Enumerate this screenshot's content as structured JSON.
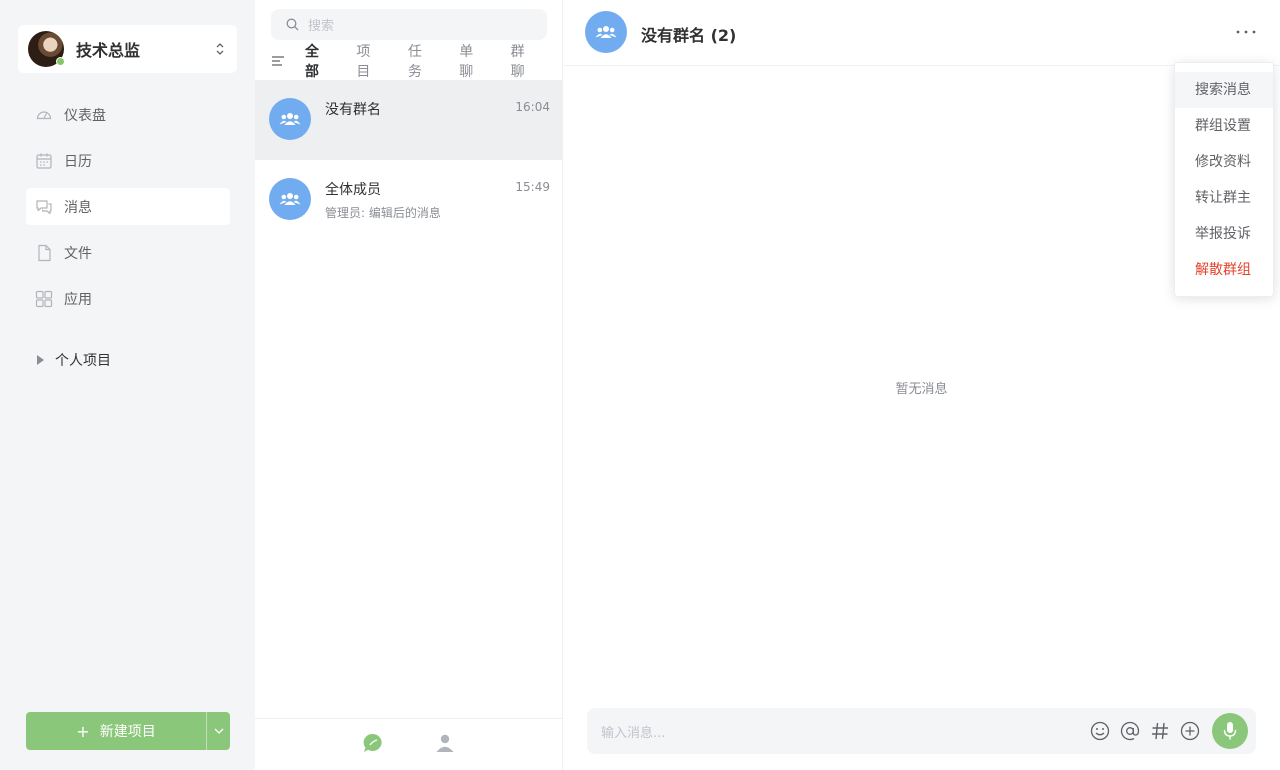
{
  "user": {
    "name": "技术总监",
    "status": "online"
  },
  "nav": [
    {
      "label": "仪表盘",
      "icon": "dashboard-icon"
    },
    {
      "label": "日历",
      "icon": "calendar-icon"
    },
    {
      "label": "消息",
      "icon": "message-icon",
      "active": true
    },
    {
      "label": "文件",
      "icon": "file-icon"
    },
    {
      "label": "应用",
      "icon": "apps-icon"
    }
  ],
  "personal_projects": {
    "label": "个人项目"
  },
  "new_project": {
    "label": "新建项目"
  },
  "search": {
    "placeholder": "搜索"
  },
  "filters": [
    "全部",
    "项目",
    "任务",
    "单聊",
    "群聊"
  ],
  "active_filter": "全部",
  "conversations": [
    {
      "name": "没有群名",
      "time": "16:04",
      "preview": "",
      "active": true
    },
    {
      "name": "全体成员",
      "time": "15:49",
      "preview": "管理员: 编辑后的消息"
    }
  ],
  "chat": {
    "title": "没有群名 (2)",
    "empty_text": "暂无消息",
    "input_placeholder": "输入消息..."
  },
  "menu": {
    "items": [
      "搜索消息",
      "群组设置",
      "修改资料",
      "转让群主",
      "举报投诉",
      "解散群组"
    ]
  },
  "colors": {
    "accent_green": "#8bc77b",
    "group_blue": "#72acf0",
    "danger_red": "#e5432d",
    "sidebar_bg": "#f4f5f7"
  }
}
